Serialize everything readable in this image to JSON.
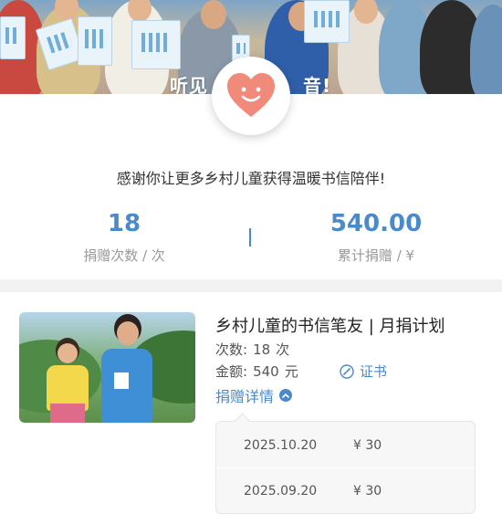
{
  "banner": {
    "text_visible": "听见",
    "text_tail": "音!"
  },
  "summary": {
    "thanks": "感谢你让更多乡村儿童获得温暖书信陪伴!",
    "donation_count": "18",
    "donation_count_label": "捐赠次数 / 次",
    "total_amount": "540.00",
    "total_amount_label": "累计捐赠 / ¥"
  },
  "project": {
    "title": "乡村儿童的书信笔友 | 月捐计划",
    "count_label": "次数:",
    "count_value": "18",
    "count_unit": "次",
    "amount_label": "金额:",
    "amount_value": "540",
    "amount_unit": "元",
    "certificate_label": "证书",
    "details_label": "捐赠详情"
  },
  "records": [
    {
      "date": "2025.10.20",
      "amount": "¥ 30"
    },
    {
      "date": "2025.09.20",
      "amount": "¥ 30"
    }
  ],
  "colors": {
    "accent": "#4a8ac9",
    "heart": "#f08a7a"
  },
  "icons": {
    "badge": "heart-smile-icon",
    "certificate": "certificate-icon",
    "details": "chevron-up-icon"
  }
}
